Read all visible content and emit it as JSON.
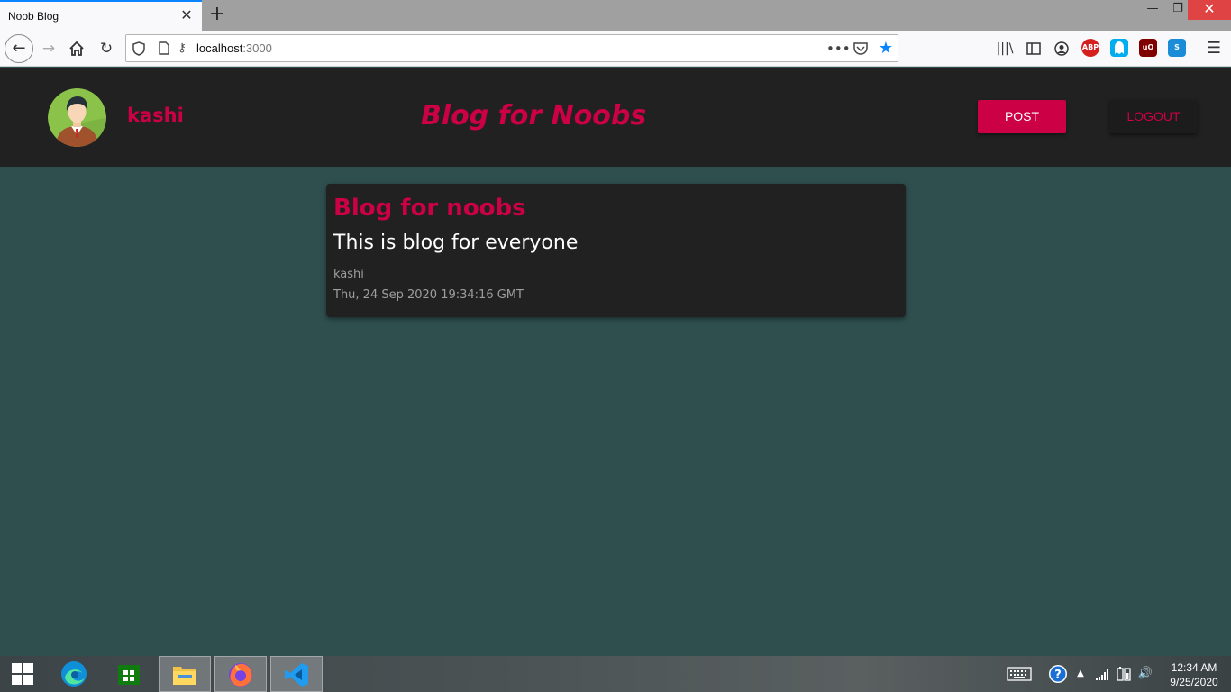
{
  "browser": {
    "tab_title": "Noob Blog",
    "tab_close": "✕",
    "new_tab": "+",
    "url_host": "localhost",
    "url_port": ":3000",
    "window_min": "—",
    "window_max": "❐",
    "window_close": "✕",
    "extensions": [
      {
        "name": "adblock-plus-icon",
        "label": "ABP",
        "color": "#d51f1f"
      },
      {
        "name": "ghostery-icon",
        "label": "",
        "color": "#00aef0"
      },
      {
        "name": "ublock-origin-icon",
        "label": "uO",
        "color": "#800000"
      },
      {
        "name": "stylus-icon",
        "label": "S",
        "color": "#1a8cd8"
      }
    ]
  },
  "header": {
    "username": "kashi",
    "site_title": "Blog for Noobs",
    "post_label": "POST",
    "logout_label": "LOGOUT"
  },
  "posts": [
    {
      "title": "Blog for noobs",
      "body": "This is blog for everyone",
      "author": "kashi",
      "date": "Thu, 24 Sep 2020 19:34:16 GMT"
    }
  ],
  "taskbar": {
    "time": "12:34 AM",
    "date": "9/25/2020"
  },
  "colors": {
    "accent": "#cc0044",
    "page_background": "#2f4f4f",
    "header_background": "#212121",
    "card_background": "#212121"
  }
}
